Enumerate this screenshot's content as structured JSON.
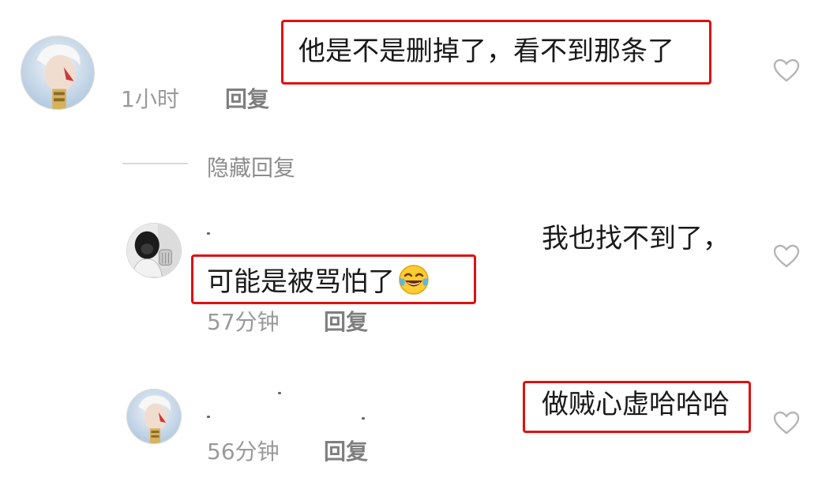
{
  "comments": [
    {
      "text": "他是不是删掉了，看不到那条了",
      "time": "1小时",
      "reply_label": "回复"
    },
    {
      "text_line1": "我也找不到了，",
      "text_line2": "可能是被骂怕了",
      "emoji": "laughing-with-tears",
      "time": "57分钟",
      "reply_label": "回复"
    },
    {
      "text": "做贼心虚哈哈哈",
      "time": "56分钟",
      "reply_label": "回复"
    }
  ],
  "thread": {
    "hide_replies_label": "隐藏回复"
  },
  "colors": {
    "highlight": "#e01010",
    "primary_text": "#1a1a1a",
    "secondary_text": "#9a9a9a"
  }
}
